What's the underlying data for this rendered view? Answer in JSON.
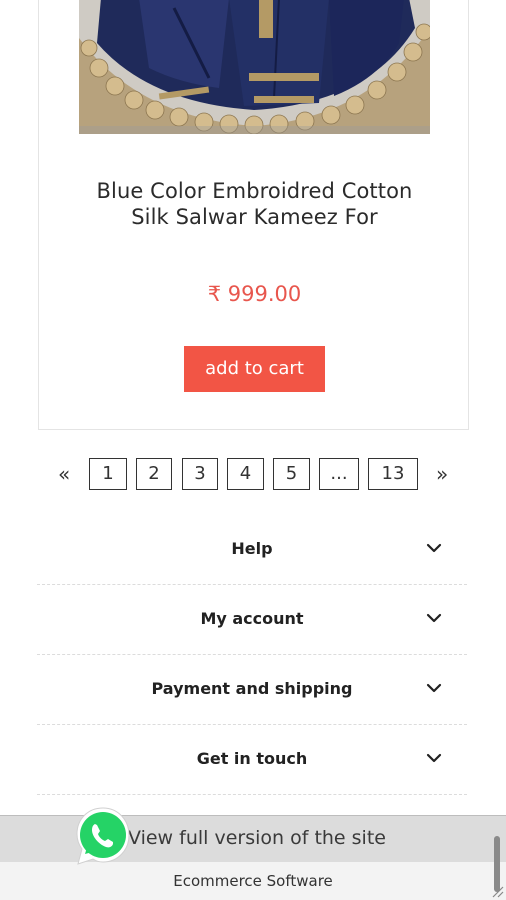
{
  "product": {
    "image_alt": "Blue salwar kameez with gold embroidered border",
    "title_line1": "Blue Color Embroidred Cotton",
    "title_line2": "Silk Salwar Kameez For",
    "price": "₹ 999.00",
    "add_to_cart_label": "add to cart"
  },
  "pagination": {
    "prev": "«",
    "next": "»",
    "pages": [
      "1",
      "2",
      "3",
      "4",
      "5",
      "...",
      "13"
    ]
  },
  "footer": {
    "sections": [
      {
        "label": "Help",
        "icon": "chevron-down-icon"
      },
      {
        "label": "My account",
        "icon": "chevron-down-icon"
      },
      {
        "label": "Payment and shipping",
        "icon": "chevron-down-icon"
      },
      {
        "label": "Get in touch",
        "icon": "chevron-down-icon"
      }
    ],
    "full_version": "View full version of the site",
    "ecommerce": "Ecommerce Software"
  },
  "colors": {
    "price": "#e8564d",
    "button": "#f25545",
    "whatsapp": "#25d366"
  }
}
